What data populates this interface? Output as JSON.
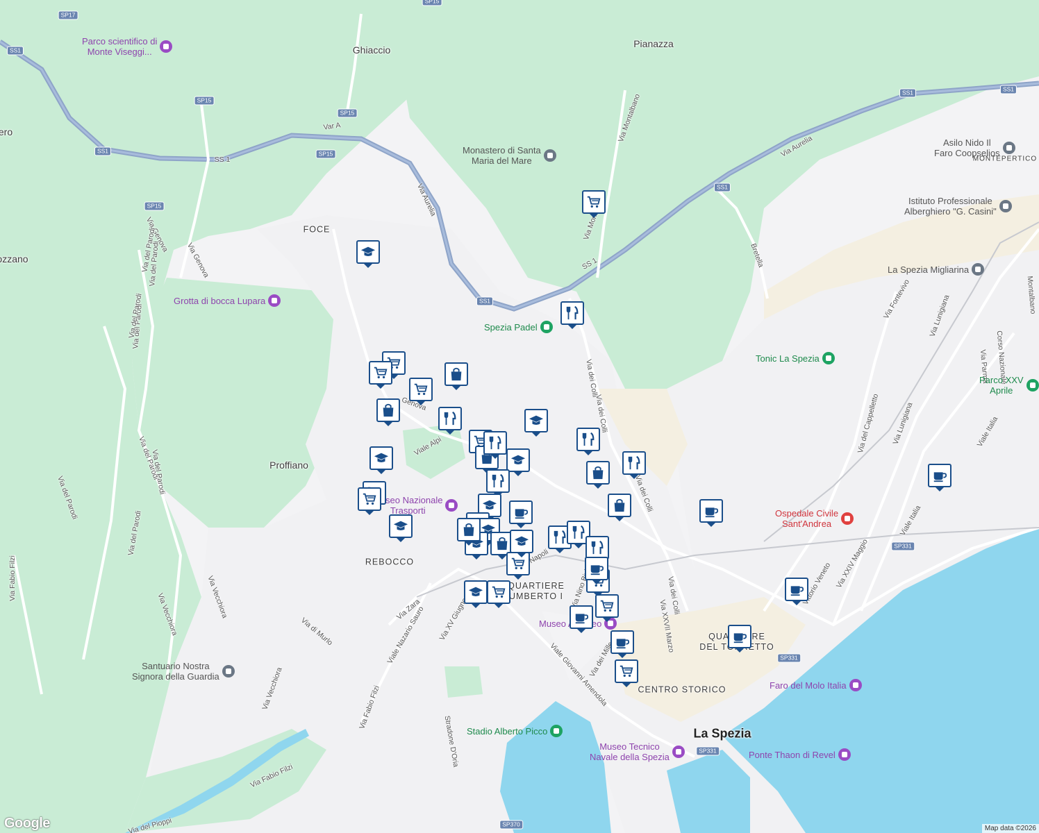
{
  "places": [
    {
      "name": "Ghiaccio"
    },
    {
      "name": "Pianazza"
    },
    {
      "name": "ero"
    },
    {
      "name": "ozzano"
    },
    {
      "name": "Proffiano"
    }
  ],
  "city": {
    "name": "La Spezia"
  },
  "districts": [
    {
      "name": "FOCE"
    },
    {
      "name": "REBOCCO"
    },
    {
      "name": "QUARTIERE\nUMBERTO I"
    },
    {
      "name": "QUARTIERE\nDEL TORRETTO"
    },
    {
      "name": "CENTRO STORICO"
    },
    {
      "name": "MONTEPERTICO"
    }
  ],
  "streets": [
    {
      "name": "Var A"
    },
    {
      "name": "SS 1"
    },
    {
      "name": "Via Aurelia"
    },
    {
      "name": "Via Aurelia"
    },
    {
      "name": "Via Genova"
    },
    {
      "name": "Via Genova"
    },
    {
      "name": "Via del Parodi"
    },
    {
      "name": "Via del Parodi"
    },
    {
      "name": "Via Montalbano"
    },
    {
      "name": "Via Montalbano"
    },
    {
      "name": "SS 1"
    },
    {
      "name": "Bretella"
    },
    {
      "name": "Via dei Colli"
    },
    {
      "name": "Via dei Colli"
    },
    {
      "name": "Via dei Colli"
    },
    {
      "name": "Via dei Colli"
    },
    {
      "name": "Genova"
    },
    {
      "name": "Viale Alpi"
    },
    {
      "name": "Via Fontevivo"
    },
    {
      "name": "Via Lunigiana"
    },
    {
      "name": "Via Lunigiana"
    },
    {
      "name": "Via del Cappelletto"
    },
    {
      "name": "Corso Nazionale"
    },
    {
      "name": "Via Parma"
    },
    {
      "name": "Viale Italia"
    },
    {
      "name": "Viale Italia"
    },
    {
      "name": "Via XXIV Maggio"
    },
    {
      "name": "Vittorio Veneto"
    },
    {
      "name": "Via Nino Bixio"
    },
    {
      "name": "Via XXVII Marzo"
    },
    {
      "name": "Via dei Mille"
    },
    {
      "name": "Via Napoli"
    },
    {
      "name": "Via Zara"
    },
    {
      "name": "Viale Nazario Sauro"
    },
    {
      "name": "Via XV Giugno"
    },
    {
      "name": "Viale Giovanni Amendola"
    },
    {
      "name": "Via di Murlo"
    },
    {
      "name": "Via Vecchiora"
    },
    {
      "name": "Via Vecchiora"
    },
    {
      "name": "Via Vecchiora"
    },
    {
      "name": "Via del Parodi"
    },
    {
      "name": "Via del Parodi"
    },
    {
      "name": "Via del Parodi"
    },
    {
      "name": "Via del Parodi"
    },
    {
      "name": "Via del Parodi"
    },
    {
      "name": "Via del Parodi"
    },
    {
      "name": "Via Fabio Filzi"
    },
    {
      "name": "Via Fabio Filzi"
    },
    {
      "name": "Via Fabio Filzi"
    },
    {
      "name": "Via del Pioppi"
    },
    {
      "name": "Stradone D'Oria"
    },
    {
      "name": "Montalbano"
    }
  ],
  "shields": [
    {
      "code": "SP17"
    },
    {
      "code": "SS1"
    },
    {
      "code": "SP15"
    },
    {
      "code": "SP15"
    },
    {
      "code": "SS1"
    },
    {
      "code": "SP15"
    },
    {
      "code": "SP15"
    },
    {
      "code": "SS1"
    },
    {
      "code": "SS1"
    },
    {
      "code": "SS1"
    },
    {
      "code": "SS1"
    },
    {
      "code": "SP331"
    },
    {
      "code": "SP331"
    },
    {
      "code": "SP331"
    },
    {
      "code": "SP370"
    },
    {
      "code": "SP15"
    }
  ],
  "pois": [
    {
      "name": "Parco scientifico di\nMonte Viseggi...",
      "color": "purple"
    },
    {
      "name": "Monastero di Santa\nMaria del Mare",
      "color": "grey"
    },
    {
      "name": "Asilo Nido Il\nFaro Coopselios",
      "color": "grey"
    },
    {
      "name": "Istituto Professionale\nAlberghiero \"G. Casini\"",
      "color": "grey"
    },
    {
      "name": "Grotta di bocca Lupara",
      "color": "purple"
    },
    {
      "name": "Spezia Padel",
      "color": "green"
    },
    {
      "name": "La Spezia Migliarina",
      "color": "grey"
    },
    {
      "name": "Tonic La Spezia",
      "color": "green"
    },
    {
      "name": "Parco XXV\nAprile",
      "color": "green"
    },
    {
      "name": "Ospedale Civile\nSant'Andrea",
      "color": "red"
    },
    {
      "name": "Museo Nazionale\nTrasporti",
      "color": "purple"
    },
    {
      "name": "Museo Amedeo",
      "color": "purple"
    },
    {
      "name": "Santuario Nostra\nSignora della Guardia",
      "color": "grey"
    },
    {
      "name": "Faro del Molo Italia",
      "color": "purple"
    },
    {
      "name": "Stadio Alberto Picco",
      "color": "green"
    },
    {
      "name": "Museo Tecnico\nNavale della Spezia",
      "color": "purple"
    },
    {
      "name": "Ponte Thaon di Revel",
      "color": "purple"
    }
  ],
  "markers": [
    {
      "type": "grocery-icon"
    },
    {
      "type": "school-icon"
    },
    {
      "type": "restaurant-icon"
    },
    {
      "type": "grocery-icon"
    },
    {
      "type": "grocery-icon"
    },
    {
      "type": "shopping-bag-icon"
    },
    {
      "type": "grocery-icon"
    },
    {
      "type": "shopping-bag-icon"
    },
    {
      "type": "restaurant-icon"
    },
    {
      "type": "school-icon"
    },
    {
      "type": "restaurant-icon"
    },
    {
      "type": "grocery-icon"
    },
    {
      "type": "shopping-bag-icon"
    },
    {
      "type": "school-icon"
    },
    {
      "type": "school-icon"
    },
    {
      "type": "restaurant-icon"
    },
    {
      "type": "restaurant-icon"
    },
    {
      "type": "shopping-bag-icon"
    },
    {
      "type": "grocery-icon"
    },
    {
      "type": "grocery-icon"
    },
    {
      "type": "shopping-bag-icon"
    },
    {
      "type": "school-icon"
    },
    {
      "type": "school-icon"
    },
    {
      "type": "cafe-icon"
    },
    {
      "type": "shopping-bag-icon"
    },
    {
      "type": "school-icon"
    },
    {
      "type": "shopping-bag-icon"
    },
    {
      "type": "school-icon"
    },
    {
      "type": "restaurant-icon"
    },
    {
      "type": "restaurant-icon"
    },
    {
      "type": "restaurant-icon"
    },
    {
      "type": "grocery-icon"
    },
    {
      "type": "school-icon"
    },
    {
      "type": "grocery-icon"
    },
    {
      "type": "cafe-icon"
    },
    {
      "type": "grocery-icon"
    },
    {
      "type": "grocery-icon"
    },
    {
      "type": "cafe-icon"
    },
    {
      "type": "cafe-icon"
    },
    {
      "type": "cafe-icon"
    },
    {
      "type": "cafe-icon"
    },
    {
      "type": "cafe-icon"
    },
    {
      "type": "grocery-icon"
    },
    {
      "type": "cafe-icon"
    },
    {
      "type": "school-icon"
    },
    {
      "type": "restaurant-icon"
    },
    {
      "type": "shopping-bag-icon"
    }
  ],
  "footer": {
    "logo": "Google",
    "attribution": "Map data ©2026"
  },
  "colors": {
    "park": "#c9ecd5",
    "water": "#8fd6ee",
    "road": "#ffffff",
    "highway": "#8ea4c8",
    "urban": "#f3f3f5",
    "sand": "#f4efe1",
    "marker": "#1a4e8a"
  }
}
